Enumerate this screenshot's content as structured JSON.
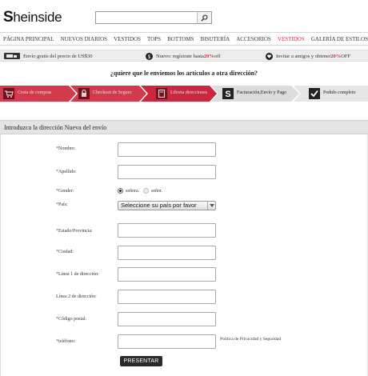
{
  "header": {
    "logo": "Sheinside",
    "search_placeholder": ""
  },
  "nav": {
    "items": [
      {
        "label": "PÁGINA PRINCIPAL",
        "active": false
      },
      {
        "label": "NUEVOS DIARIOS",
        "active": false
      },
      {
        "label": "VESTIDOS",
        "active": false
      },
      {
        "label": "TOPS",
        "active": false
      },
      {
        "label": "BOTTOMS",
        "active": false
      },
      {
        "label": "BISUTERÍA",
        "active": false
      },
      {
        "label": "ACCESORIOS",
        "active": false
      },
      {
        "label": "VESTIDOS",
        "active": true
      },
      {
        "label": "GALERÍA DE ESTILOS",
        "active": false
      }
    ]
  },
  "promo": {
    "shipping": {
      "text": "Envío gratis del precio de US$30",
      "icon": "truck-icon"
    },
    "register": {
      "text_before": "Nuevo: regístrate hasta ",
      "highlight": "20%",
      "text_after": " off",
      "icon": "dollar-icon"
    },
    "invite": {
      "text_before": "Invitar a amigos y obtener ",
      "highlight": "20%",
      "text_after": " OFF",
      "icon": "heart-icon"
    }
  },
  "question": "¿quiere que le enviemos los artículos a otra dirección?",
  "steps": [
    {
      "label": "Cesta de compras",
      "icon": "cart-icon",
      "state": "done"
    },
    {
      "label": "Checkout de Seguro",
      "icon": "lock-icon",
      "state": "done"
    },
    {
      "label": "Libreta direcciones",
      "icon": "book-icon",
      "state": "current"
    },
    {
      "label": "Facturación,Envío y Pago",
      "icon": "dollar-icon",
      "state": "pending"
    },
    {
      "label": "Pedido completo",
      "icon": "check-icon",
      "state": "pending"
    }
  ],
  "form": {
    "title": "Introduzca la dirección Nueva del envío",
    "labels": {
      "nombre": "Nombre:",
      "apellido": "Apellido:",
      "gender": "Gender:",
      "pais": "País:",
      "estado": "Estado/Provincia:",
      "ciudad": "Ciudad:",
      "linea1": "Línea 1 de dirección:",
      "linea2": "Línea 2 de dirección:",
      "codigo": "Código postal:",
      "telefono": "teléfono:"
    },
    "gender_options": [
      "señora.",
      "señor."
    ],
    "gender_selected": "señora.",
    "country_selected": "Seleccione su país por favor",
    "privacy": "Política de Privacidad y Seguridad",
    "submit": "PRESENTAR"
  },
  "colors": {
    "accent": "#c8334a",
    "step_done": "#d43a4e",
    "step_pending": "#d9d9d9",
    "nav_active": "#c8334a"
  }
}
